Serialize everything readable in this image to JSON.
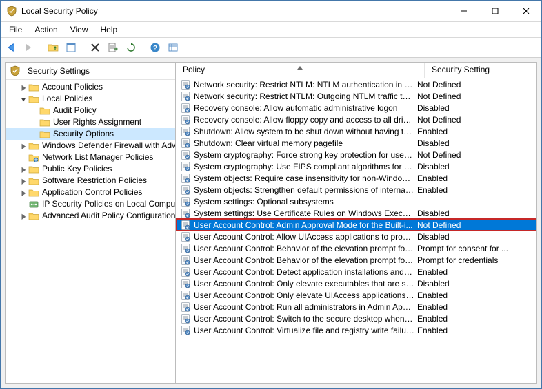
{
  "window": {
    "title": "Local Security Policy"
  },
  "menubar": {
    "items": [
      "File",
      "Action",
      "View",
      "Help"
    ]
  },
  "tree": {
    "rootLabel": "Security Settings",
    "nodes": [
      {
        "label": "Account Policies",
        "depth": 1,
        "expandable": true,
        "expanded": false,
        "icon": "folder"
      },
      {
        "label": "Local Policies",
        "depth": 1,
        "expandable": true,
        "expanded": true,
        "icon": "folder"
      },
      {
        "label": "Audit Policy",
        "depth": 2,
        "expandable": false,
        "icon": "folder"
      },
      {
        "label": "User Rights Assignment",
        "depth": 2,
        "expandable": false,
        "icon": "folder"
      },
      {
        "label": "Security Options",
        "depth": 2,
        "expandable": false,
        "icon": "folder",
        "selected": true
      },
      {
        "label": "Windows Defender Firewall with Advanced Security",
        "depth": 1,
        "expandable": true,
        "expanded": false,
        "icon": "folder"
      },
      {
        "label": "Network List Manager Policies",
        "depth": 1,
        "expandable": false,
        "icon": "folder-net"
      },
      {
        "label": "Public Key Policies",
        "depth": 1,
        "expandable": true,
        "expanded": false,
        "icon": "folder"
      },
      {
        "label": "Software Restriction Policies",
        "depth": 1,
        "expandable": true,
        "expanded": false,
        "icon": "folder"
      },
      {
        "label": "Application Control Policies",
        "depth": 1,
        "expandable": true,
        "expanded": false,
        "icon": "folder"
      },
      {
        "label": "IP Security Policies on Local Computer",
        "depth": 1,
        "expandable": false,
        "icon": "ipsec"
      },
      {
        "label": "Advanced Audit Policy Configuration",
        "depth": 1,
        "expandable": true,
        "expanded": false,
        "icon": "folder"
      }
    ]
  },
  "list": {
    "columns": {
      "policy": "Policy",
      "setting": "Security Setting"
    },
    "rows": [
      {
        "policy": "Network security: Restrict NTLM: NTLM authentication in thi...",
        "setting": "Not Defined"
      },
      {
        "policy": "Network security: Restrict NTLM: Outgoing NTLM traffic to r...",
        "setting": "Not Defined"
      },
      {
        "policy": "Recovery console: Allow automatic administrative logon",
        "setting": "Disabled"
      },
      {
        "policy": "Recovery console: Allow floppy copy and access to all drives...",
        "setting": "Not Defined"
      },
      {
        "policy": "Shutdown: Allow system to be shut down without having to...",
        "setting": "Enabled"
      },
      {
        "policy": "Shutdown: Clear virtual memory pagefile",
        "setting": "Disabled"
      },
      {
        "policy": "System cryptography: Force strong key protection for user k...",
        "setting": "Not Defined"
      },
      {
        "policy": "System cryptography: Use FIPS compliant algorithms for en...",
        "setting": "Disabled"
      },
      {
        "policy": "System objects: Require case insensitivity for non-Windows ...",
        "setting": "Enabled"
      },
      {
        "policy": "System objects: Strengthen default permissions of internal s...",
        "setting": "Enabled"
      },
      {
        "policy": "System settings: Optional subsystems",
        "setting": ""
      },
      {
        "policy": "System settings: Use Certificate Rules on Windows Executab...",
        "setting": "Disabled"
      },
      {
        "policy": "User Account Control: Admin Approval Mode for the Built-i...",
        "setting": "Not Defined",
        "selected": true
      },
      {
        "policy": "User Account Control: Allow UIAccess applications to prom...",
        "setting": "Disabled"
      },
      {
        "policy": "User Account Control: Behavior of the elevation prompt for ...",
        "setting": "Prompt for consent for ..."
      },
      {
        "policy": "User Account Control: Behavior of the elevation prompt for ...",
        "setting": "Prompt for credentials"
      },
      {
        "policy": "User Account Control: Detect application installations and p...",
        "setting": "Enabled"
      },
      {
        "policy": "User Account Control: Only elevate executables that are sig...",
        "setting": "Disabled"
      },
      {
        "policy": "User Account Control: Only elevate UIAccess applications th...",
        "setting": "Enabled"
      },
      {
        "policy": "User Account Control: Run all administrators in Admin Appr...",
        "setting": "Enabled"
      },
      {
        "policy": "User Account Control: Switch to the secure desktop when pr...",
        "setting": "Enabled"
      },
      {
        "policy": "User Account Control: Virtualize file and registry write failure...",
        "setting": "Enabled"
      }
    ]
  }
}
